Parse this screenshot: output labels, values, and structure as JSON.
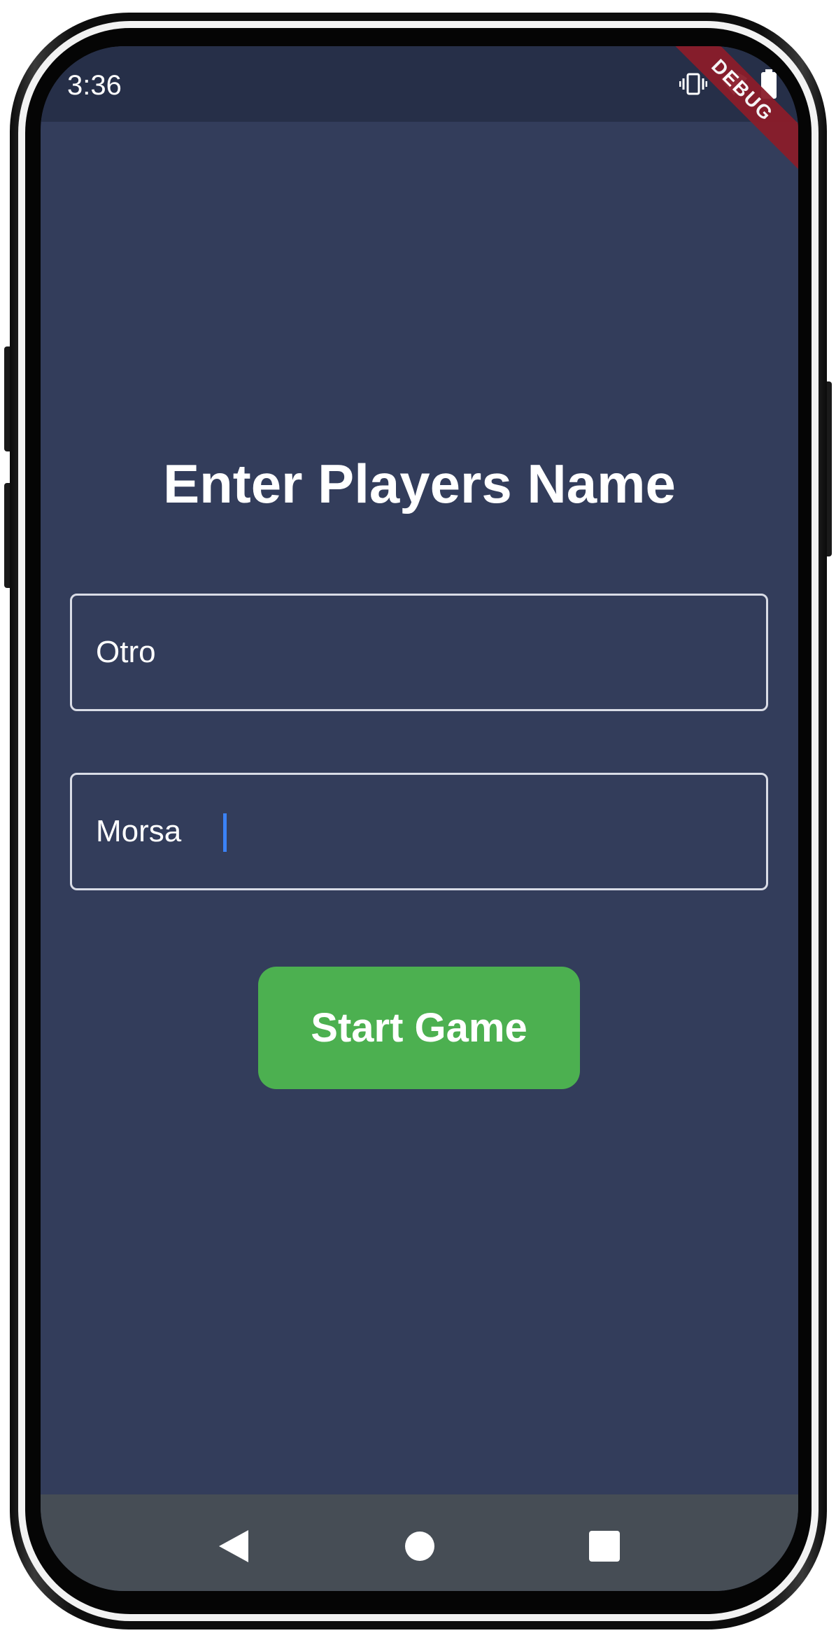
{
  "status_bar": {
    "time": "3:36",
    "icons": [
      "vibrate-icon",
      "wifi-icon",
      "battery-icon"
    ]
  },
  "debug_banner": "DEBUG",
  "main": {
    "title": "Enter Players Name",
    "player1": {
      "value": "Otro"
    },
    "player2": {
      "value": "Morsa"
    },
    "start_button": "Start Game"
  },
  "nav_bar": {
    "buttons": [
      "back-icon",
      "home-icon",
      "recents-icon"
    ]
  },
  "colors": {
    "background": "#333d5b",
    "status_bar": "#262f48",
    "button": "#4cb050",
    "nav_bar": "#464d55",
    "caret": "#3b82f6"
  }
}
